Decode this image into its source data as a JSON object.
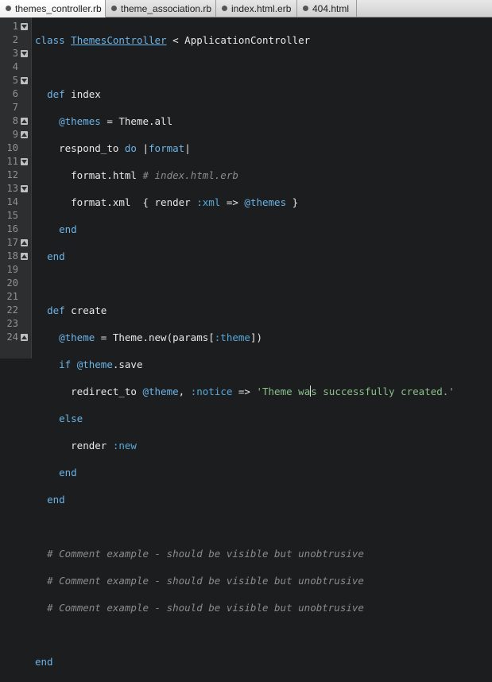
{
  "tabs": [
    {
      "label": "themes_controller.rb",
      "active": true
    },
    {
      "label": "theme_association.rb",
      "active": false
    },
    {
      "label": "index.html.erb",
      "active": false
    },
    {
      "label": "404.html",
      "active": false
    }
  ],
  "line_numbers": [
    "1",
    "2",
    "3",
    "4",
    "5",
    "6",
    "7",
    "8",
    "9",
    "10",
    "11",
    "12",
    "13",
    "14",
    "15",
    "16",
    "17",
    "18",
    "19",
    "20",
    "21",
    "22",
    "23",
    "24"
  ],
  "code": {
    "l1_class": "class",
    "l1_name": "ThemesController",
    "l1_rest": " < ApplicationController",
    "l3_def": "def",
    "l3_name": " index",
    "l4_ivar": "@themes",
    "l4_rest": " = Theme.all",
    "l5_a": "respond_to ",
    "l5_do": "do",
    "l5_b": " |",
    "l5_format": "format",
    "l5_c": "|",
    "l6_a": "format.html ",
    "l6_cmt": "# index.html.erb",
    "l7_a": "format.xml  { render ",
    "l7_sym": ":xml",
    "l7_b": " => ",
    "l7_ivar": "@themes",
    "l7_c": " }",
    "l8_end": "end",
    "l9_end": "end",
    "l11_def": "def",
    "l11_name": " create",
    "l12_ivar": "@theme",
    "l12_a": " = Theme.new(params[",
    "l12_sym": ":theme",
    "l12_b": "])",
    "l13_if": "if",
    "l13_ivar": " @theme",
    "l13_rest": ".save",
    "l14_a": "redirect_to ",
    "l14_ivar": "@theme",
    "l14_b": ", ",
    "l14_sym": ":notice",
    "l14_c": " => ",
    "l14_str1": "'Theme wa",
    "l14_str2": "s successfully created.'",
    "l15_else": "else",
    "l16_a": "render ",
    "l16_sym": ":new",
    "l17_end": "end",
    "l18_end": "end",
    "l20_cmt": "# Comment example - should be visible but unobtrusive",
    "l21_cmt": "# Comment example - should be visible but unobtrusive",
    "l22_cmt": "# Comment example - should be visible but unobtrusive",
    "l24_end": "end"
  },
  "colors": {
    "background": "#1b1d1e",
    "keyword": "#6cb4e8",
    "string": "#8ac08a",
    "comment": "#8a8c8d"
  }
}
